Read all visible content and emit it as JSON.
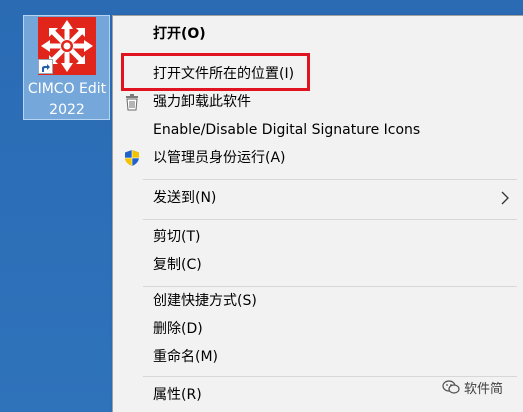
{
  "desktop": {
    "icon": {
      "label_line1": "CIMCO Edit",
      "label_line2": "2022",
      "logo_color": "#e1251b",
      "icon_name": "cimco-edit-logo"
    }
  },
  "context_menu": {
    "items": [
      {
        "label": "打开(O)",
        "bold": true,
        "icon": null
      },
      {
        "label": "打开文件所在的位置(I)",
        "highlighted": true,
        "icon": null
      },
      {
        "label": "强力卸载此软件",
        "icon": "uninstall-trash-icon"
      },
      {
        "label": "Enable/Disable Digital Signature Icons",
        "icon": null
      },
      {
        "label": "以管理员身份运行(A)",
        "icon": "uac-shield-icon"
      },
      {
        "label": "发送到(N)",
        "has_submenu": true,
        "icon": null
      },
      {
        "label": "剪切(T)",
        "icon": null
      },
      {
        "label": "复制(C)",
        "icon": null
      },
      {
        "label": "创建快捷方式(S)",
        "icon": null
      },
      {
        "label": "删除(D)",
        "icon": null
      },
      {
        "label": "重命名(M)",
        "icon": null
      },
      {
        "label": "属性(R)",
        "icon": null
      }
    ],
    "highlight_color": "#e0141e"
  },
  "watermark": {
    "text": "软件简"
  }
}
